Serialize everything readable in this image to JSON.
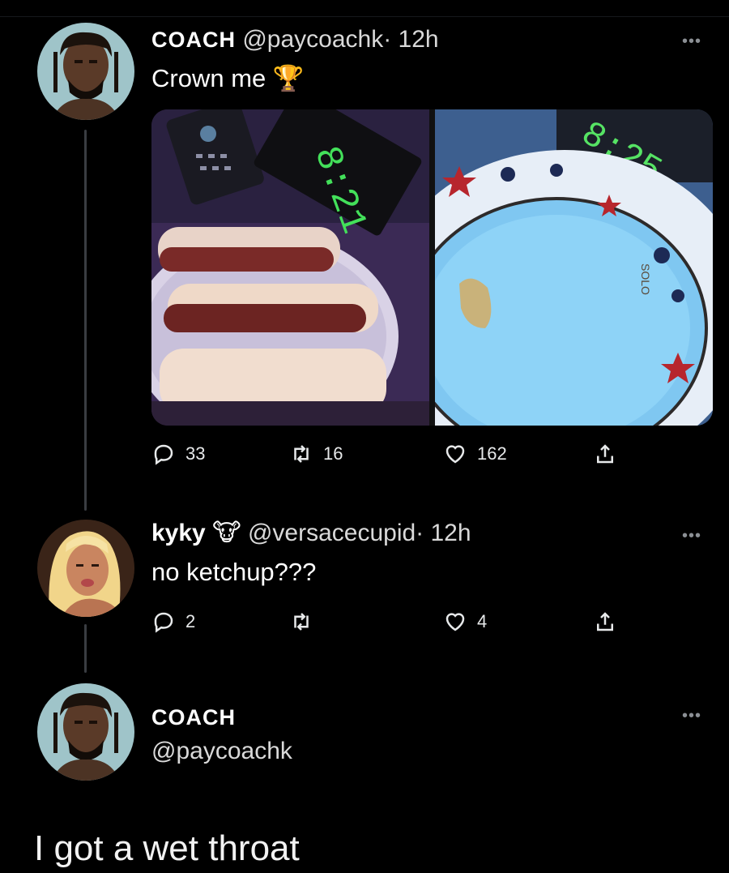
{
  "tweets": [
    {
      "display_name": "COACH",
      "handle": "@paycoachk",
      "time": "· 12h",
      "text": "Crown me",
      "emoji": "🏆",
      "replies": "33",
      "retweets": "16",
      "likes": "162",
      "media": [
        {
          "clock": "8:21"
        },
        {
          "clock": "8:25",
          "plate_text": "SOLO"
        }
      ]
    },
    {
      "display_name": "kyky",
      "emoji": "🐮",
      "handle": "@versacecupid",
      "time": "· 12h",
      "text": "no ketchup???",
      "replies": "2",
      "likes": "4"
    },
    {
      "display_name": "COACH",
      "handle": "@paycoachk",
      "text": "I got a wet throat"
    }
  ],
  "more_label": "•••",
  "colors": {
    "background": "#000000",
    "thread_line": "#3a3d42",
    "text": "#ffffff"
  },
  "icons": [
    "reply-icon",
    "retweet-icon",
    "like-icon",
    "share-icon",
    "more-icon"
  ]
}
